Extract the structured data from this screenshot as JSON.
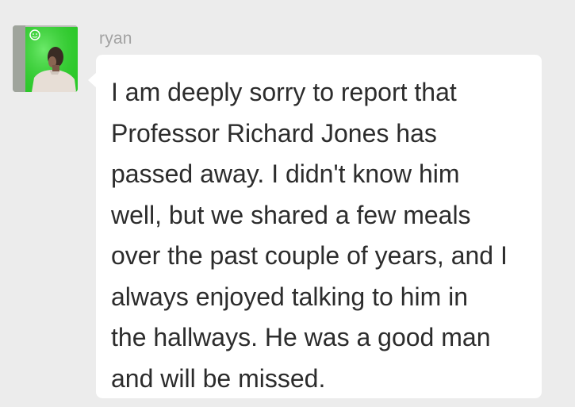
{
  "chat": {
    "message": {
      "sender": "ryan",
      "avatar_icon": "user-photo-avatar",
      "text": "I am deeply sorry to report that\nProfessor Richard Jones has\npassed away. I didn't know him\nwell, but we shared a few meals\nover the past couple of years, and I\nalways enjoyed talking to him in\nthe hallways. He was a good man\nand will be missed."
    },
    "colors": {
      "background": "#ececec",
      "bubble": "#ffffff",
      "text": "#2c2c2c",
      "sender_name": "#a2a2a2"
    }
  }
}
